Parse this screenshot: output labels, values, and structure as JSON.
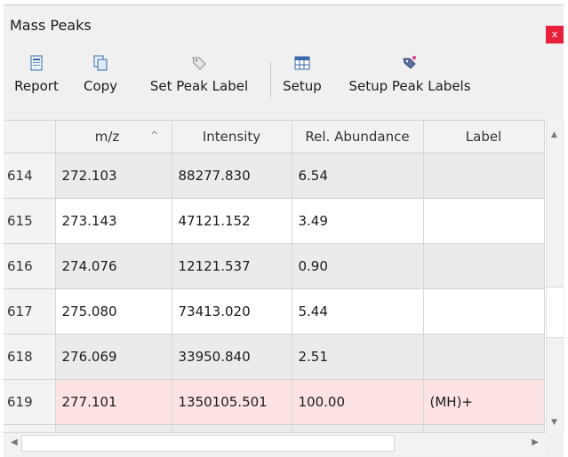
{
  "window": {
    "title": "Mass Peaks",
    "close_label": "x"
  },
  "toolbar": {
    "report": "Report",
    "copy": "Copy",
    "set_peak_label": "Set Peak Label",
    "setup": "Setup",
    "setup_peak_labels": "Setup Peak Labels"
  },
  "table": {
    "columns": [
      "",
      "m/z",
      "Intensity",
      "Rel. Abundance",
      "Label"
    ],
    "sorted_column": "m/z",
    "sort_indicator": "^",
    "rows": [
      {
        "num": "614",
        "mz": "272.103",
        "intensity": "88277.830",
        "rel": "6.54",
        "label": ""
      },
      {
        "num": "615",
        "mz": "273.143",
        "intensity": "47121.152",
        "rel": "3.49",
        "label": ""
      },
      {
        "num": "616",
        "mz": "274.076",
        "intensity": "12121.537",
        "rel": "0.90",
        "label": ""
      },
      {
        "num": "617",
        "mz": "275.080",
        "intensity": "73413.020",
        "rel": "5.44",
        "label": ""
      },
      {
        "num": "618",
        "mz": "276.069",
        "intensity": "33950.840",
        "rel": "2.51",
        "label": ""
      },
      {
        "num": "619",
        "mz": "277.101",
        "intensity": "1350105.501",
        "rel": "100.00",
        "label": "(MH)+"
      }
    ]
  },
  "colors": {
    "highlight_row": "#fde2e3",
    "close_button": "#e8203c"
  },
  "icons": [
    "report-icon",
    "copy-icon",
    "tag-icon",
    "grid-setup-icon",
    "tag-setup-icon"
  ]
}
